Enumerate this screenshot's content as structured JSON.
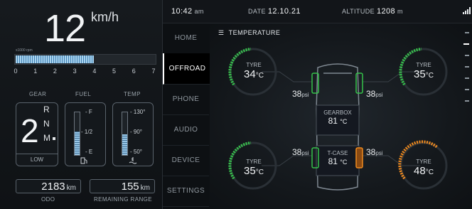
{
  "speed": {
    "value": "12",
    "unit": "km/h"
  },
  "rpm": {
    "caption": "x1000 rpm",
    "fill_fraction": 0.56,
    "ticks": [
      "0",
      "1",
      "2",
      "3",
      "4",
      "5",
      "6",
      "7"
    ]
  },
  "gear": {
    "label": "GEAR",
    "current": "2",
    "options": [
      "R",
      "N",
      "M"
    ],
    "mode": "LOW"
  },
  "fuel": {
    "label": "FUEL",
    "ticks": [
      "F",
      "1/2",
      "E"
    ],
    "level_fraction": 0.55
  },
  "temp": {
    "label": "TEMP",
    "ticks": [
      "130°",
      "90°",
      "50°"
    ],
    "level_fraction": 0.48
  },
  "odo": {
    "value": "2183",
    "unit": "km",
    "label": "ODO"
  },
  "range": {
    "value": "155",
    "unit": "km",
    "label": "REMAINING RANGE"
  },
  "status": {
    "time": "10:42",
    "ampm": "am",
    "date_label": "DATE",
    "date": "12.10.21",
    "alt_label": "ALTITUDE",
    "alt_value": "1208",
    "alt_unit": "m"
  },
  "nav": [
    "HOME",
    "OFFROAD",
    "PHONE",
    "AUDIO",
    "DEVICE",
    "SETTINGS"
  ],
  "nav_active": "OFFROAD",
  "panel_title": "TEMPERATURE",
  "tyres": {
    "fl": {
      "label": "TYRE",
      "temp": "34",
      "unit": "°C",
      "psi": "38",
      "psi_unit": "psi",
      "color": "#35c24a"
    },
    "fr": {
      "label": "TYRE",
      "temp": "35",
      "unit": "°C",
      "psi": "38",
      "psi_unit": "psi",
      "color": "#35c24a"
    },
    "rl": {
      "label": "TYRE",
      "temp": "35",
      "unit": "°C",
      "psi": "38",
      "psi_unit": "psi",
      "color": "#35c24a"
    },
    "rr": {
      "label": "TYRE",
      "temp": "48",
      "unit": "°C",
      "psi": "38",
      "psi_unit": "psi",
      "color": "#f08a1e"
    }
  },
  "gearbox": {
    "label": "GEARBOX",
    "temp": "81",
    "unit": "°C"
  },
  "tcase": {
    "label": "T-CASE",
    "temp": "81",
    "unit": "°C"
  }
}
